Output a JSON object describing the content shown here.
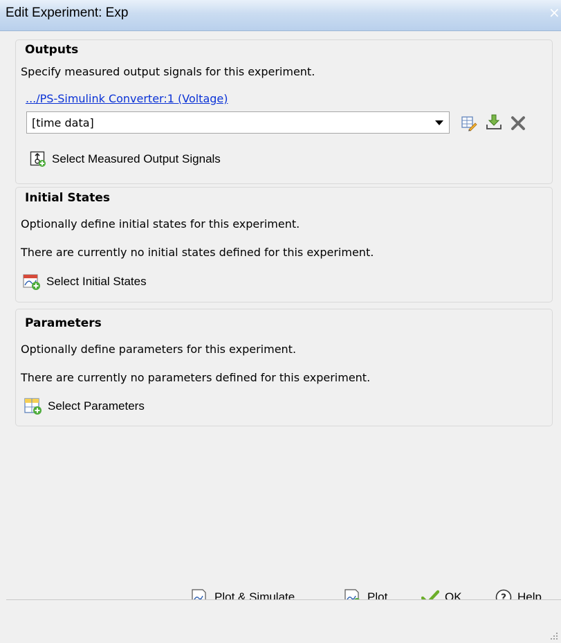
{
  "window": {
    "title": "Edit Experiment: Exp",
    "close_glyph": "×"
  },
  "outputs": {
    "heading": "Outputs",
    "description": "Specify measured output signals for this experiment.",
    "signal_link": ".../PS-Simulink Converter:1 (Voltage)",
    "data_value": "[time data]",
    "select_button": "Select Measured Output Signals",
    "icons": [
      "edit-data-icon",
      "import-data-icon",
      "delete-icon"
    ]
  },
  "initial_states": {
    "heading": "Initial States",
    "description": "Optionally define initial states for this experiment.",
    "status": "There are currently no initial states defined for this experiment.",
    "select_button": "Select Initial States"
  },
  "parameters": {
    "heading": "Parameters",
    "description": "Optionally define parameters for this experiment.",
    "status": "There are currently no parameters defined for this experiment.",
    "select_button": "Select Parameters"
  },
  "footer": {
    "plot_simulate": "Plot & Simulate",
    "plot": "Plot",
    "ok": "OK",
    "help": "Help"
  },
  "colors": {
    "link": "#0b33d6",
    "ok_check": "#6cae2a",
    "titlebar": "#cadcf1"
  }
}
